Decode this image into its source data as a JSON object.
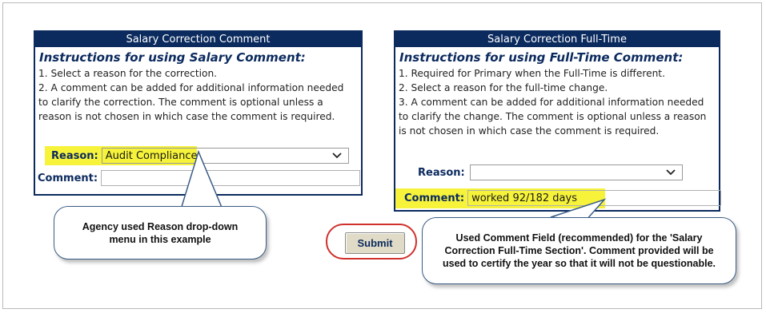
{
  "left_panel": {
    "title": "Salary Correction Comment",
    "instructions_heading": "Instructions for using Salary Comment:",
    "steps": [
      "1. Select a reason for the correction.",
      "2. A comment can be added for additional information needed",
      "to clarify the correction.  The comment is optional unless a",
      "reason is not chosen in which case the comment is required."
    ],
    "reason_label": "Reason:",
    "reason_value": "Audit Compliance",
    "comment_label": "Comment:",
    "comment_value": ""
  },
  "right_panel": {
    "title": "Salary Correction Full-Time",
    "instructions_heading": "Instructions for using Full-Time Comment:",
    "steps": [
      "1. Required for Primary when the Full-Time is different.",
      "2. Select a reason for the full-time change.",
      "3. A comment can be added for additional information needed",
      "to clarify the change.  The comment is optional unless a reason",
      "is not chosen in which case the comment is required."
    ],
    "reason_label": "Reason:",
    "reason_value": "",
    "comment_label": "Comment:",
    "comment_value": "worked 92/182 days"
  },
  "submit_label": "Submit",
  "callouts": {
    "left": "Agency used Reason drop-down menu in this example",
    "right": "Used Comment Field (recommended) for the 'Salary Correction Full-Time Section'.  Comment provided will be used to certify the year so that it will not be questionable."
  },
  "colors": {
    "header_navy": "#0b2a5e",
    "highlight_yellow": "#f6f33a",
    "submit_ring_red": "#d0302c",
    "submit_bg": "#e0dbc6"
  },
  "icons": {
    "dropdown": "chevron-down-icon"
  }
}
